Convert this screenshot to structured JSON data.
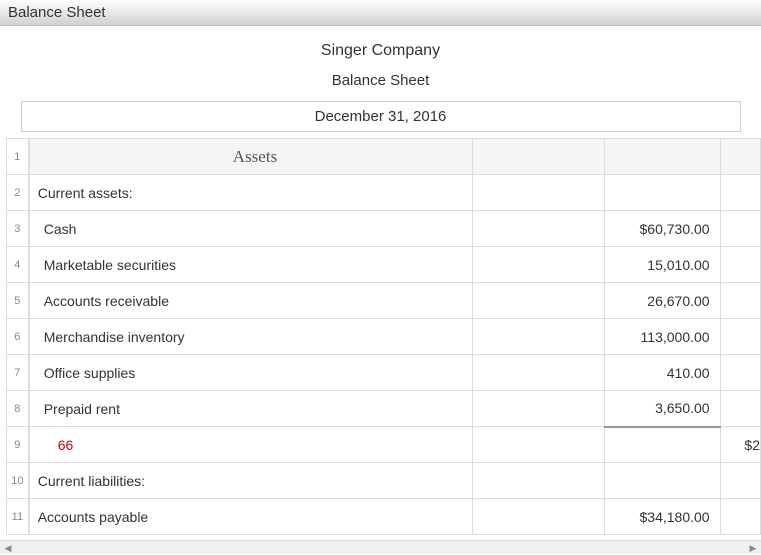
{
  "window": {
    "title": "Balance Sheet"
  },
  "header": {
    "company": "Singer Company",
    "doc_title": "Balance Sheet",
    "date": "December 31, 2016"
  },
  "rows": [
    {
      "num": "1",
      "label": "Assets",
      "section": true
    },
    {
      "num": "2",
      "label": "Current assets:",
      "indent": 0
    },
    {
      "num": "3",
      "label": "Cash",
      "indent": 1,
      "col_c": "$60,730.00"
    },
    {
      "num": "4",
      "label": "Marketable securities",
      "indent": 1,
      "col_c": "15,010.00"
    },
    {
      "num": "5",
      "label": "Accounts receivable",
      "indent": 1,
      "col_c": "26,670.00"
    },
    {
      "num": "6",
      "label": "Merchandise inventory",
      "indent": 1,
      "col_c": "113,000.00"
    },
    {
      "num": "7",
      "label": "Office supplies",
      "indent": 1,
      "col_c": "410.00"
    },
    {
      "num": "8",
      "label": "Prepaid rent",
      "indent": 1,
      "col_c": "3,650.00",
      "underline_c": true
    },
    {
      "num": "9",
      "label": "66",
      "indent": 2,
      "red": true,
      "col_d": "$2"
    },
    {
      "num": "10",
      "label": "Current liabilities:",
      "indent": 0
    },
    {
      "num": "11",
      "label": "Accounts payable",
      "indent": 0,
      "col_c": "$34,180.00"
    }
  ],
  "scroll": {
    "left_glyph": "◀",
    "right_glyph": "▶"
  }
}
